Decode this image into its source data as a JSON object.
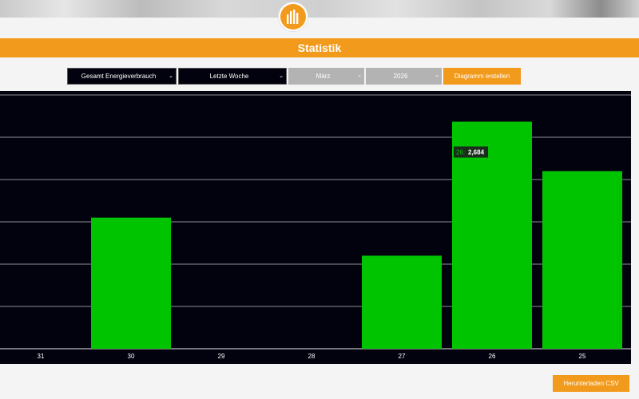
{
  "header": {
    "title": "Statistik",
    "logo_icon": "bar-chart-icon"
  },
  "controls": {
    "type_select": "Gesamt Energieverbrauch",
    "period_select": "Letzte Woche",
    "month_select": "März",
    "year_select": "2026",
    "create_button": "Diagramm erstellen"
  },
  "chart_data": {
    "type": "bar",
    "categories": [
      "31",
      "30",
      "29",
      "28",
      "27",
      "26",
      "25"
    ],
    "series": [
      {
        "values": [
          0,
          1.55,
          0,
          0,
          1.1,
          2.684,
          2.1
        ]
      }
    ],
    "ylim": [
      0,
      3
    ],
    "grid": true,
    "bar_color": "#00c400",
    "tooltip": {
      "label": "26:",
      "value": "2,684"
    }
  },
  "footer": {
    "csv_button": "Herunterladen CSV"
  },
  "colors": {
    "accent": "#f29a1c",
    "chart_bg": "#02020f",
    "bar": "#00c400"
  }
}
